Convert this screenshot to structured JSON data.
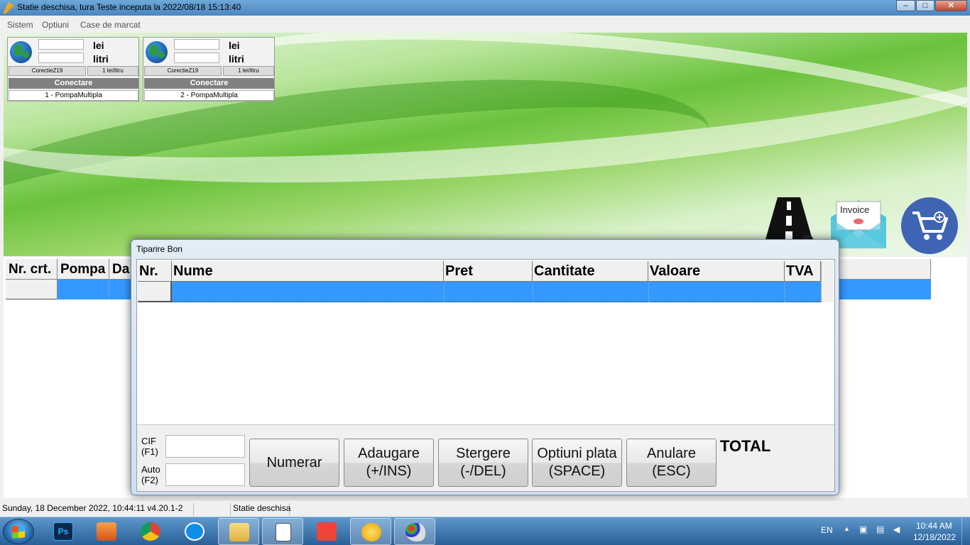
{
  "window": {
    "title": "Statie deschisa, tura Teste inceputa la 2022/08/18 15:13:40",
    "min_label": "–",
    "max_label": "□",
    "close_label": "✕"
  },
  "menu": [
    "Sistem",
    "Optiuni",
    "Case de marcat"
  ],
  "pumps": [
    {
      "unit1": "lei",
      "unit2": "litri",
      "correction": "CorectieZ19",
      "rate": "1 lei/litru",
      "connect": "Conectare",
      "name": "1 - PompaMultipla"
    },
    {
      "unit1": "lei",
      "unit2": "litri",
      "correction": "CorectieZ19",
      "rate": "1 lei/litru",
      "connect": "Conectare",
      "name": "2 - PompaMultipla"
    }
  ],
  "invoice_icon_text": "Invoice",
  "main_table": {
    "columns": [
      "Nr. crt.",
      "Pompa",
      "Da"
    ]
  },
  "dialog": {
    "title": "Tiparire Bon",
    "columns": [
      "Nr.",
      "Nume",
      "Pret",
      "Cantitate",
      "Valoare",
      "TVA"
    ],
    "cif_label_1": "CIF",
    "cif_label_2": "(F1)",
    "auto_label_1": "Auto",
    "auto_label_2": "(F2)",
    "buttons": [
      {
        "l1": "Numerar",
        "l2": ""
      },
      {
        "l1": "Adaugare",
        "l2": "(+/INS)"
      },
      {
        "l1": "Stergere",
        "l2": "(-/DEL)"
      },
      {
        "l1": "Optiuni plata",
        "l2": "(SPACE)"
      },
      {
        "l1": "Anulare",
        "l2": "(ESC)"
      }
    ],
    "total_label": "TOTAL"
  },
  "statusbar": {
    "datetime": "Sunday, 18 December 2022, 10:44:11 v4.20.1-2",
    "status": "Statie deschisa"
  },
  "taskbar": {
    "lang": "EN",
    "time": "10:44 AM",
    "date": "12/18/2022",
    "apps": [
      "photoshop",
      "media-player",
      "chrome",
      "teamviewer",
      "file-explorer",
      "document-app",
      "anydesk",
      "sun-app",
      "paint-app"
    ]
  },
  "colors": {
    "selection": "#3399ff",
    "accent": "#3e64b3"
  }
}
